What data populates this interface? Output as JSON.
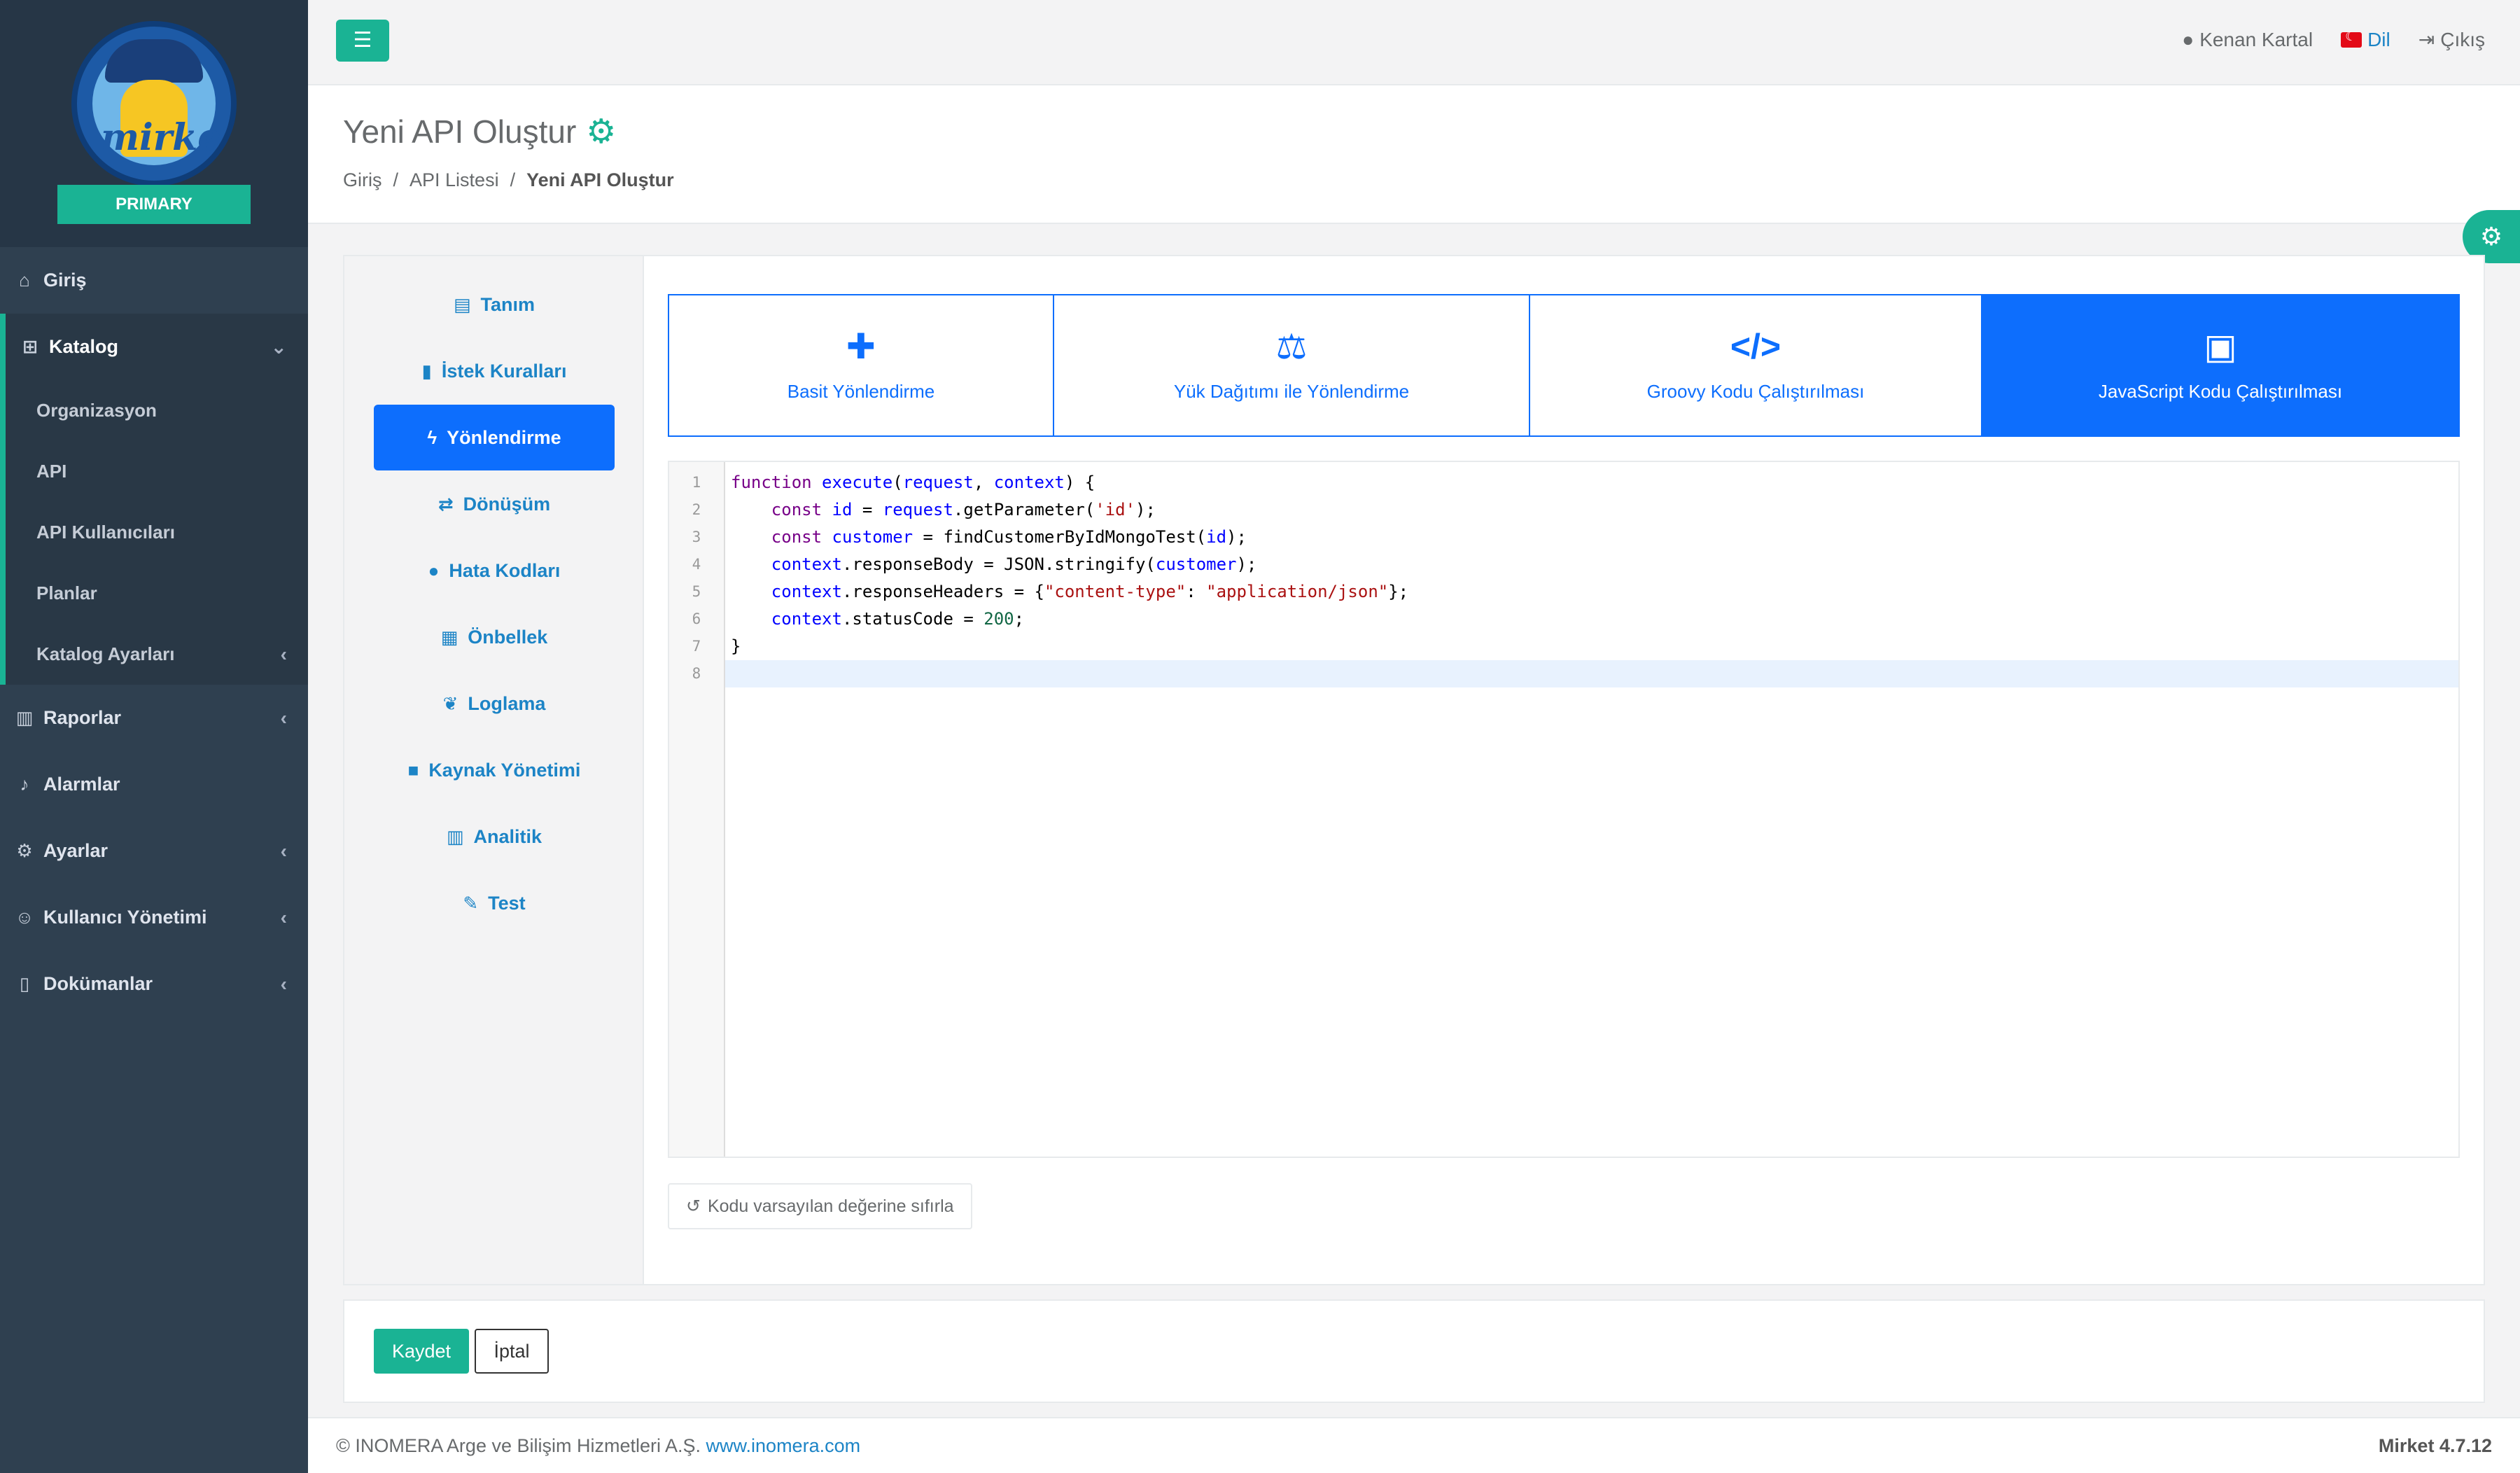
{
  "logo": {
    "text": "mirket",
    "ribbon": "PRIMARY"
  },
  "sidebar": {
    "items": [
      {
        "label": "Giriş",
        "icon": "home-icon"
      },
      {
        "label": "Katalog",
        "icon": "sitemap-icon",
        "expanded": true
      },
      {
        "label": "Raporlar",
        "icon": "chart-icon"
      },
      {
        "label": "Alarmlar",
        "icon": "bell-icon"
      },
      {
        "label": "Ayarlar",
        "icon": "gears-icon"
      },
      {
        "label": "Kullanıcı Yönetimi",
        "icon": "users-icon"
      },
      {
        "label": "Dokümanlar",
        "icon": "file-icon"
      }
    ],
    "katalog_sub": [
      {
        "label": "Organizasyon"
      },
      {
        "label": "API"
      },
      {
        "label": "API Kullanıcıları"
      },
      {
        "label": "Planlar"
      },
      {
        "label": "Katalog Ayarları"
      }
    ]
  },
  "topbar": {
    "user": "Kenan Kartal",
    "language": "Dil",
    "logout": "Çıkış"
  },
  "header": {
    "title": "Yeni API Oluştur",
    "breadcrumb": [
      "Giriş",
      "API Listesi",
      "Yeni API Oluştur"
    ]
  },
  "subnav": {
    "items": [
      {
        "label": "Tanım",
        "icon": "id-card-icon"
      },
      {
        "label": "İstek Kuralları",
        "icon": "document-icon"
      },
      {
        "label": "Yönlendirme",
        "icon": "bolt-icon",
        "active": true
      },
      {
        "label": "Dönüşüm",
        "icon": "exchange-icon"
      },
      {
        "label": "Hata Kodları",
        "icon": "exclamation-icon"
      },
      {
        "label": "Önbellek",
        "icon": "memory-icon"
      },
      {
        "label": "Loglama",
        "icon": "leaf-icon"
      },
      {
        "label": "Kaynak Yönetimi",
        "icon": "lock-icon"
      },
      {
        "label": "Analitik",
        "icon": "chart-icon"
      },
      {
        "label": "Test",
        "icon": "pencil-icon"
      }
    ]
  },
  "routing_tabs": [
    {
      "label": "Basit Yönlendirme",
      "icon": "puzzle-icon"
    },
    {
      "label": "Yük Dağıtımı ile Yönlendirme",
      "icon": "balance-scale-icon"
    },
    {
      "label": "Groovy Kodu Çalıştırılması",
      "icon": "code-icon"
    },
    {
      "label": "JavaScript Kodu Çalıştırılması",
      "icon": "laptop-code-icon",
      "active": true
    }
  ],
  "editor": {
    "line_numbers": [
      "1",
      "2",
      "3",
      "4",
      "5",
      "6",
      "7",
      "8"
    ],
    "lines": [
      "function execute(request, context) {",
      "    const id = request.getParameter('id');",
      "    const customer = findCustomerByIdMongoTest(id);",
      "    context.responseBody = JSON.stringify(customer);",
      "    context.responseHeaders = {\"content-type\": \"application/json\"};",
      "    context.statusCode = 200;",
      "}",
      ""
    ]
  },
  "reset_button": "Kodu varsayılan değerine sıfırla",
  "actions": {
    "save": "Kaydet",
    "cancel": "İptal"
  },
  "footer": {
    "copyright": "© INOMERA Arge ve Bilişim Hizmetleri A.Ş.",
    "link": "www.inomera.com",
    "version": "Mirket 4.7.12"
  },
  "colors": {
    "accent": "#1ab394",
    "primary": "#0d6efd",
    "sidebar": "#2f4050",
    "link": "#1c84c6"
  }
}
